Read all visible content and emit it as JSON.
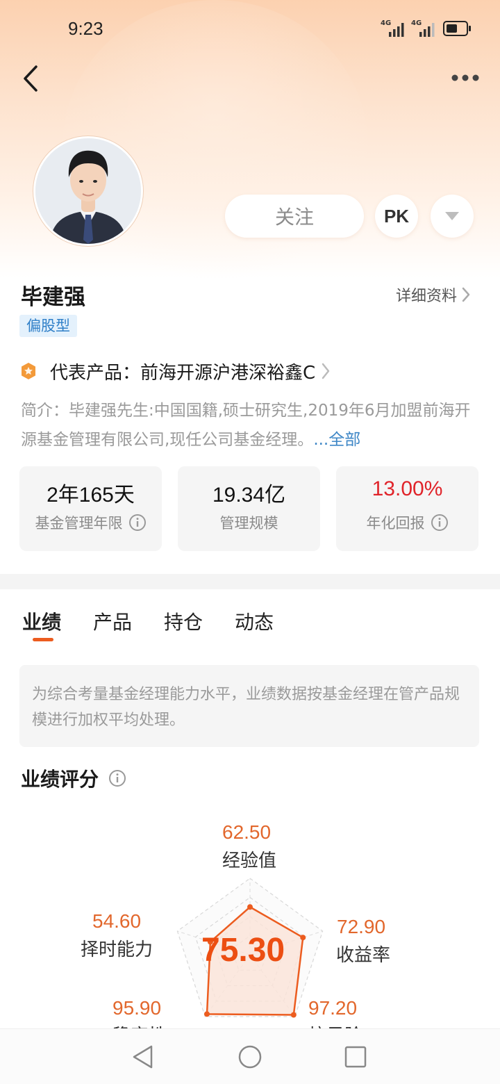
{
  "status_bar": {
    "time": "9:23",
    "network_1": "4G",
    "network_2": "4G",
    "battery_level": 0.6
  },
  "header": {
    "back_icon": "chevron-left-icon",
    "more_icon": "more-dots-icon"
  },
  "profile": {
    "follow_label": "关注",
    "pk_label": "PK",
    "name": "毕建强",
    "detail_link": "详细资料",
    "type_badge": "偏股型",
    "representative_product": "代表产品：前海开源沪港深裕鑫C",
    "intro_text": "简介：毕建强先生:中国国籍,硕士研究生,2019年6月加盟前海开源基金管理有限公司,现任公司基金经理。",
    "intro_more": "...全部"
  },
  "stats": [
    {
      "value": "2年165天",
      "label": "基金管理年限",
      "has_info": true
    },
    {
      "value": "19.34亿",
      "label": "管理规模",
      "has_info": false
    },
    {
      "value": "13.00%",
      "label": "年化回报",
      "has_info": true
    }
  ],
  "tabs": [
    {
      "label": "业绩",
      "active": true
    },
    {
      "label": "产品",
      "active": false
    },
    {
      "label": "持仓",
      "active": false
    },
    {
      "label": "动态",
      "active": false
    }
  ],
  "performance": {
    "note": "为综合考量基金经理能力水平，业绩数据按基金经理在管产品规模进行加权平均处理。",
    "section_title": "业绩评分",
    "total_score": "75.30",
    "axes": [
      {
        "label": "经验值",
        "value": "62.50"
      },
      {
        "label": "收益率",
        "value": "72.90"
      },
      {
        "label": "抗风险",
        "value": "97.20"
      },
      {
        "label": "稳定性",
        "value": "95.90"
      },
      {
        "label": "择时能力",
        "value": "54.60"
      }
    ]
  },
  "colors": {
    "accent": "#ec5c1f",
    "score": "#ec4e12",
    "radar_fill": "#fbe4d8",
    "return_red": "#e0242a",
    "link_blue": "#3d86c6"
  }
}
